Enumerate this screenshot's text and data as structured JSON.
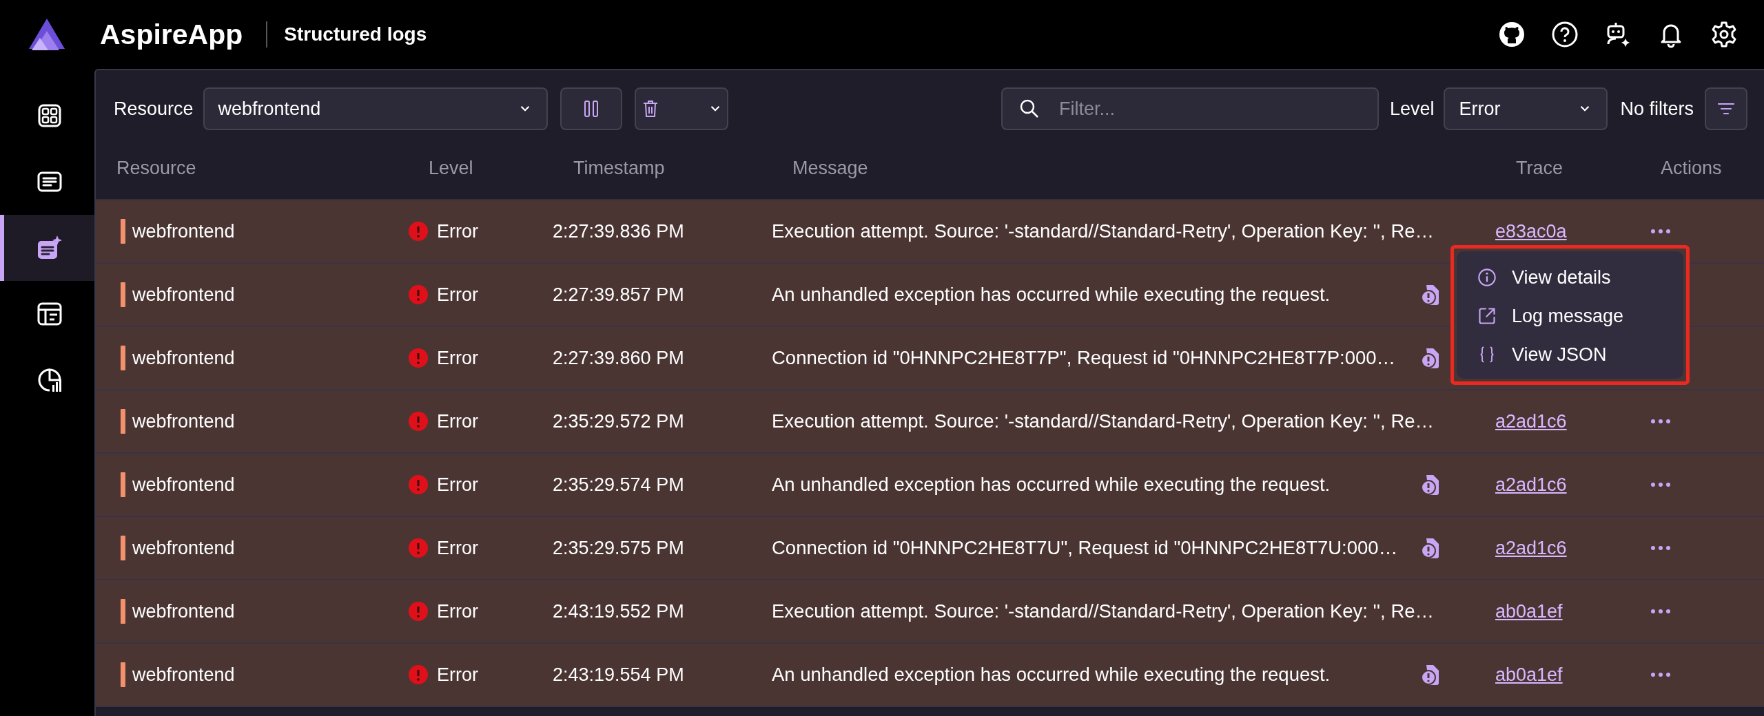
{
  "header": {
    "app_name": "AspireApp",
    "page_title": "Structured logs"
  },
  "sidebar": {
    "items": [
      {
        "kind": "grid",
        "selected": false
      },
      {
        "kind": "lines",
        "selected": false
      },
      {
        "kind": "doc-sparkle",
        "selected": true
      },
      {
        "kind": "panels",
        "selected": false
      },
      {
        "kind": "chart",
        "selected": false
      }
    ]
  },
  "toolbar": {
    "resource_label": "Resource",
    "resource_value": "webfrontend",
    "filter_placeholder": "Filter...",
    "level_label": "Level",
    "level_value": "Error",
    "filters_status": "No filters"
  },
  "table": {
    "columns": [
      "Resource",
      "Level",
      "Timestamp",
      "Message",
      "Trace",
      "Actions"
    ],
    "rows": [
      {
        "resource": "webfrontend",
        "level": "Error",
        "timestamp": "2:27:39.836 PM",
        "message": "Execution attempt. Source: '-standard//Standard-Retry', Operation Key: '', Re…",
        "exception": false,
        "trace": "e83ac0a",
        "actions": true
      },
      {
        "resource": "webfrontend",
        "level": "Error",
        "timestamp": "2:27:39.857 PM",
        "message": "An unhandled exception has occurred while executing the request.",
        "exception": true,
        "actions": false
      },
      {
        "resource": "webfrontend",
        "level": "Error",
        "timestamp": "2:27:39.860 PM",
        "message": "Connection id \"0HNNPC2HE8T7P\", Request id \"0HNNPC2HE8T7P:000…",
        "exception": true,
        "actions": false
      },
      {
        "resource": "webfrontend",
        "level": "Error",
        "timestamp": "2:35:29.572 PM",
        "message": "Execution attempt. Source: '-standard//Standard-Retry', Operation Key: '', Re…",
        "exception": false,
        "trace": "a2ad1c6",
        "actions": true
      },
      {
        "resource": "webfrontend",
        "level": "Error",
        "timestamp": "2:35:29.574 PM",
        "message": "An unhandled exception has occurred while executing the request.",
        "exception": true,
        "trace": "a2ad1c6",
        "actions": true
      },
      {
        "resource": "webfrontend",
        "level": "Error",
        "timestamp": "2:35:29.575 PM",
        "message": "Connection id \"0HNNPC2HE8T7U\", Request id \"0HNNPC2HE8T7U:000…",
        "exception": true,
        "trace": "a2ad1c6",
        "actions": true
      },
      {
        "resource": "webfrontend",
        "level": "Error",
        "timestamp": "2:43:19.552 PM",
        "message": "Execution attempt. Source: '-standard//Standard-Retry', Operation Key: '', Re…",
        "exception": false,
        "trace": "ab0a1ef",
        "actions": true
      },
      {
        "resource": "webfrontend",
        "level": "Error",
        "timestamp": "2:43:19.554 PM",
        "message": "An unhandled exception has occurred while executing the request.",
        "exception": true,
        "trace": "ab0a1ef",
        "actions": true
      }
    ]
  },
  "context_menu": {
    "items": [
      {
        "kind": "info",
        "label": "View details"
      },
      {
        "kind": "external",
        "label": "Log message"
      },
      {
        "kind": "braces",
        "label": "View JSON"
      }
    ]
  }
}
